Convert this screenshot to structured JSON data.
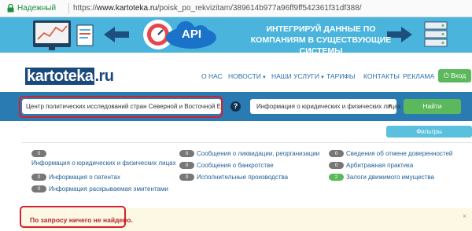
{
  "address_bar": {
    "secure_label": "Надежный",
    "url_scheme": "https://",
    "url_host": "www.kartoteka.ru",
    "url_path": "/poisk_po_rekvizitam/389614b977a96ff9ff542361f31df388/"
  },
  "banner": {
    "api_label": "API",
    "headline": "ИНТЕГРИРУЙ ДАННЫЕ ПО КОМПАНИЯМ В СУЩЕСТВУЮЩИЕ СИСТЕМЫ"
  },
  "nav": {
    "logo_main": "kartoteka",
    "logo_suffix": ".ru",
    "items": [
      {
        "label": "О НАС",
        "caret": false
      },
      {
        "label": "НОВОСТИ",
        "caret": true
      },
      {
        "label": "НАШИ УСЛУГИ",
        "caret": true
      },
      {
        "label": "ТАРИФЫ",
        "caret": false
      },
      {
        "label": "КОНТАКТЫ",
        "caret": false
      },
      {
        "label": "РЕКЛАМА",
        "caret": false
      }
    ],
    "login_label": "Вход",
    "login_icon": "power-icon"
  },
  "search": {
    "query_value": "Центр политических исследований стран Северной и Восточной Европы",
    "help_symbol": "?",
    "select_value": "Информация о юридических и физических лицах",
    "find_label": "Найти"
  },
  "filters": {
    "button_label": "Фильтры",
    "items": [
      {
        "count": "0",
        "label": "Информация о юридических и физических лицах",
        "highlight": false
      },
      {
        "count": "0",
        "label": "Информация о патентах",
        "highlight": false
      },
      {
        "count": "0",
        "label": "Информация раскрываемая эмитентами",
        "highlight": false
      },
      {
        "count": "0",
        "label": "Сообщения о ликвидации, реорганизации",
        "highlight": false
      },
      {
        "count": "0",
        "label": "Сообщения о банкротстве",
        "highlight": false
      },
      {
        "count": "0",
        "label": "Исполнительные производства",
        "highlight": false
      },
      {
        "count": "0",
        "label": "Сведения об отмене доверенностей",
        "highlight": false
      },
      {
        "count": "0",
        "label": "Арбитражная практика",
        "highlight": false
      },
      {
        "count": "2",
        "label": "Залоги движимого имущества",
        "highlight": true
      }
    ]
  },
  "alert": {
    "message": "По запросу ничего не найдено.",
    "close_symbol": "×"
  },
  "colors": {
    "brand_blue": "#2a7bb1",
    "banner_blue": "#4ab4dd",
    "accent_green": "#5cb85c",
    "annotation_red": "#d61f2c",
    "alert_bg": "#fcf8e3",
    "alert_text": "#b5272d"
  }
}
